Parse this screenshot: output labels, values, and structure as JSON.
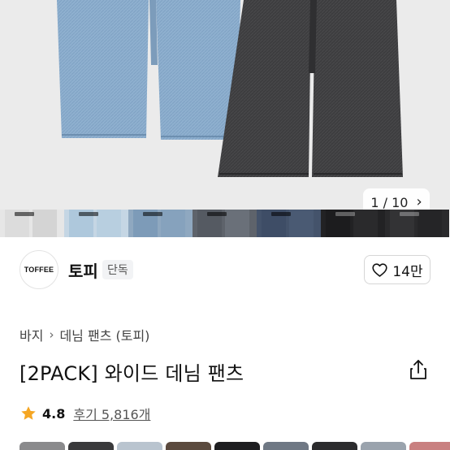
{
  "gallery": {
    "current": "1",
    "total": "10",
    "pager_text": "1 / 10",
    "next_icon": "chevron-right-icon",
    "thumbnail_colors": [
      "#e6e6e6",
      "#aec8dc",
      "#7d9bb8",
      "#555a62",
      "#3e4d66",
      "#1c1c1e",
      "#2a2a2c"
    ]
  },
  "brand": {
    "logo_text": "TOFFEE",
    "name": "토피",
    "badge": "단독",
    "likes": "14만",
    "like_icon": "heart-outline-icon"
  },
  "product": {
    "breadcrumb": [
      "바지",
      "데님 팬츠 (토피)"
    ],
    "breadcrumb_sep_icon": "chevron-right-icon",
    "title": "[2PACK] 와이드 데님 팬츠",
    "share_icon": "share-icon",
    "rating": "4.8",
    "rating_icon": "star-icon",
    "reviews": "후기 5,816개"
  },
  "colors": {
    "light_denim": "#8fb0cf",
    "black_denim": "#3d3d3f",
    "star": "#f5a623"
  }
}
